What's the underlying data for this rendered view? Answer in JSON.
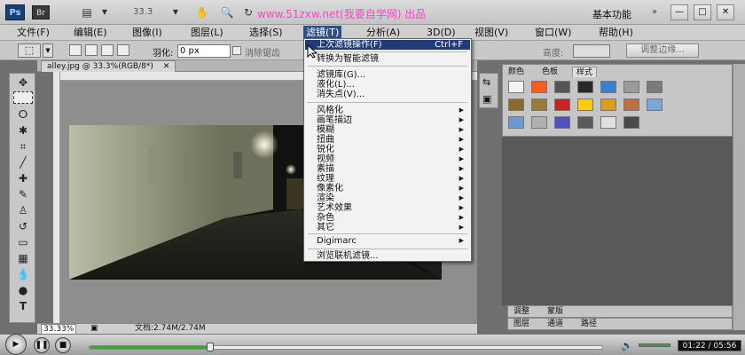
{
  "topbar": {
    "ps_logo": "Ps",
    "br_logo": "Br",
    "zoom": "33.3",
    "watermark": "www.51zxw.net(我要自学网) 出品",
    "workspace": "基本功能",
    "win_min": "—",
    "win_max": "□",
    "win_close": "✕"
  },
  "menubar": {
    "items": [
      "文件(F)",
      "编辑(E)",
      "图像(I)",
      "图层(L)",
      "选择(S)",
      "滤镜(T)",
      "分析(A)",
      "3D(D)",
      "视图(V)",
      "窗口(W)",
      "帮助(H)"
    ]
  },
  "options": {
    "feather_label": "羽化:",
    "feather_value": "0 px",
    "antialias_label": "消除锯齿",
    "height_label": "高度:",
    "refine_edge": "调整边缘..."
  },
  "document": {
    "tab_title": "alley.jpg @ 33.3%(RGB/8*)",
    "tab_close": "✕",
    "zoom_status": "33.33%",
    "doc_info": "文档:2.74M/2.74M"
  },
  "filter_menu": {
    "last_filter": "上次滤镜操作(F)",
    "last_filter_shortcut": "Ctrl+F",
    "smart": "转换为智能滤镜",
    "gallery": "滤镜库(G)...",
    "liquify": "液化(L)...",
    "vanishing": "消失点(V)...",
    "submenus": [
      "风格化",
      "画笔描边",
      "模糊",
      "扭曲",
      "锐化",
      "视频",
      "素描",
      "纹理",
      "像素化",
      "渲染",
      "艺术效果",
      "杂色",
      "其它"
    ],
    "digimarc": "Digimarc",
    "browse": "浏览联机滤镜..."
  },
  "panels": {
    "swatch_tabs": [
      "颜色",
      "色板",
      "样式"
    ],
    "adjust_tabs": [
      "调整",
      "蒙版"
    ],
    "layer_tabs": [
      "图层",
      "通道",
      "路径"
    ],
    "style_colors": [
      "#f4f4f4",
      "#ff5a1a",
      "#555555",
      "#2a2a2a",
      "#3a7fd0",
      "#9a9a9a",
      "#7a7a7a",
      "#8a6a2a",
      "#9a7a3a",
      "#cc2222",
      "#ffcc00",
      "#d9a020",
      "#c07040",
      "#78a8d8",
      "#6a9ad0",
      "#b0b0b0",
      "#5050c0",
      "#5a5a5a",
      "#e0e0e0",
      "#4a4a4a"
    ]
  },
  "player": {
    "timecode": "01:22 / 05:56",
    "progress": 0.235
  }
}
